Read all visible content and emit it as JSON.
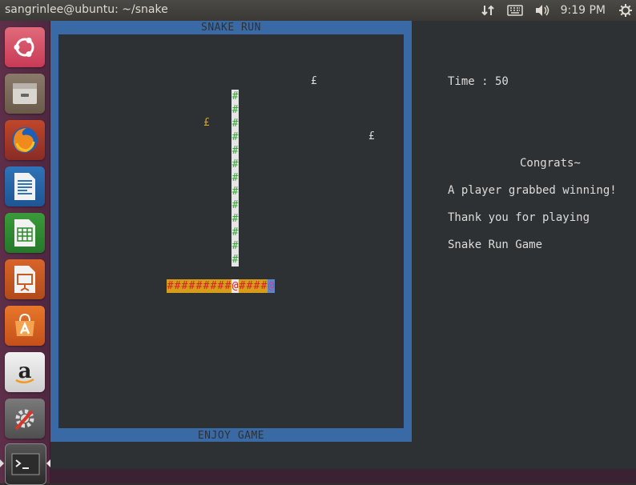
{
  "window": {
    "title": "sangrinlee@ubuntu: ~/snake"
  },
  "tray": {
    "clock": "9:19 PM",
    "icons": [
      "network-arrows-icon",
      "keyboard-icon",
      "volume-icon",
      "gear-icon"
    ]
  },
  "launcher": [
    "ubuntu-dash-icon",
    "files-icon",
    "firefox-icon",
    "writer-icon",
    "calc-icon",
    "impress-icon",
    "software-center-icon",
    "amazon-icon",
    "system-settings-icon",
    "terminal-icon"
  ],
  "game": {
    "header": "SNAKE RUN",
    "footer": "ENJOY GAME",
    "food_glyph": "£",
    "vertical_snake_glyph": "#",
    "horizontal_snake": "#########@####@",
    "head_glyph": "@"
  },
  "side": {
    "time": "Time : 50",
    "congrats": "Congrats~",
    "line1": "A player grabbed winning!",
    "line2": "Thank you for playing",
    "line3": "Snake Run Game"
  },
  "colors": {
    "frame": "#3a6aa5",
    "terminal_bg": "#2e3133",
    "snake_vertical": "#3aa83a",
    "snake_horizontal_bg": "#d79d1a",
    "snake_horizontal_fg": "#d32323",
    "launcher_bg": "#5a2d44"
  }
}
